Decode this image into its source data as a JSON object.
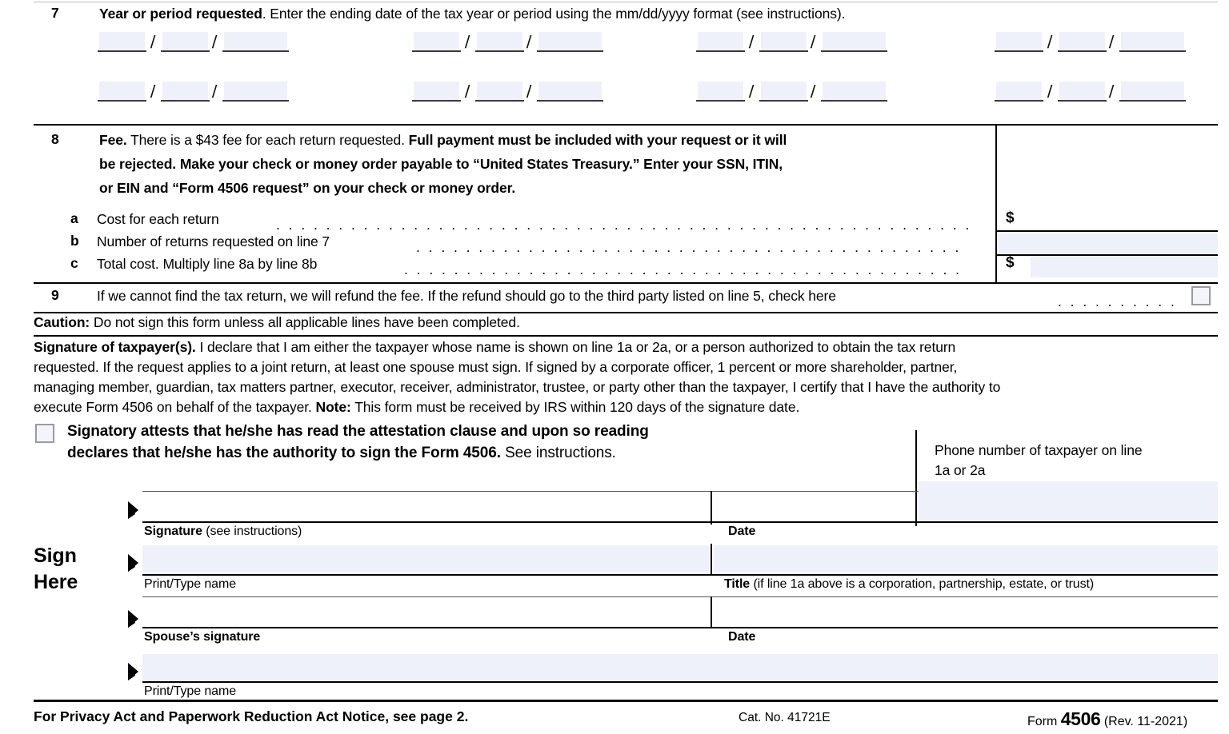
{
  "form": {
    "title": "Form 4506",
    "revision": "(Rev. 11-2021)",
    "catalog_number": "Cat. No. 41721E",
    "privacy_notice": "For Privacy Act and Paperwork Reduction Act Notice, see page 2.",
    "form_label": "Form",
    "form_number": "4506"
  },
  "line7": {
    "number": "7",
    "label_bold": "Year or period requested",
    "label_rest": ". Enter the ending date of the tax year or period using the mm/dd/yyyy format (see instructions).",
    "separator": "/",
    "date_groups": [
      {
        "month": "",
        "day": "",
        "year": ""
      },
      {
        "month": "",
        "day": "",
        "year": ""
      },
      {
        "month": "",
        "day": "",
        "year": ""
      },
      {
        "month": "",
        "day": "",
        "year": ""
      },
      {
        "month": "",
        "day": "",
        "year": ""
      },
      {
        "month": "",
        "day": "",
        "year": ""
      },
      {
        "month": "",
        "day": "",
        "year": ""
      },
      {
        "month": "",
        "day": "",
        "year": ""
      }
    ]
  },
  "line8": {
    "number": "8",
    "head_bold_1": "Fee.",
    "head_plain_1": " There is a $43 fee for each return requested. ",
    "head_bold_2": "Full payment must be included with your request or it will",
    "head_bold_3": "be rejected. Make your check or money order payable to “United States Treasury.” Enter your SSN, ITIN,",
    "head_bold_4": "or EIN and “Form 4506 request” on your check or money order.",
    "rows": [
      {
        "letter": "a",
        "text": "Cost for each return",
        "currency": "$",
        "value": ""
      },
      {
        "letter": "b",
        "text": "Number of returns requested on line 7",
        "currency": "",
        "value": ""
      },
      {
        "letter": "c",
        "text": "Total cost. Multiply line 8a by line 8b",
        "currency": "$",
        "value": ""
      }
    ]
  },
  "line9": {
    "number": "9",
    "text": "If we cannot find the tax return, we will refund the fee. If the refund should go to the third party listed on line 5, check here",
    "checkbox_checked": false
  },
  "caution": {
    "bold": "Caution:",
    "text": " Do not sign this form unless all applicable lines have been completed."
  },
  "signature_block": {
    "heading_bold": "Signature of taxpayer(s).",
    "para_line1": " I declare that I am either the taxpayer whose name is shown on line 1a or 2a, or a person authorized to obtain the tax return",
    "para_line2": "requested. If the request applies to a joint return, at least one spouse must sign. If signed by a corporate officer, 1 percent or more shareholder, partner,",
    "para_line3": "managing member, guardian, tax matters partner, executor, receiver, administrator, trustee, or party other than the taxpayer, I certify that I have the authority to",
    "para_line4_a": "execute Form 4506 on behalf of the taxpayer. ",
    "para_line4_note": "Note:",
    "para_line4_b": " This form must be received by IRS within 120 days of the signature date."
  },
  "attestation": {
    "checkbox_checked": false,
    "bold_line1": "Signatory attests that he/she has read the attestation clause and upon so reading",
    "bold_line2": "declares that he/she has the authority to sign the Form 4506.",
    "plain_line2": " See instructions."
  },
  "phone": {
    "label_line1": "Phone number of taxpayer on line",
    "label_line2": "1a or 2a",
    "value": ""
  },
  "sign_here": {
    "label_line1": "Sign",
    "label_line2": "Here",
    "rows": [
      {
        "left_label_bold": "Signature",
        "left_label_plain": " (see instructions)",
        "right_label_bold": "Date",
        "right_label_plain": "",
        "left_value": "",
        "right_value": ""
      },
      {
        "left_label_bold": "",
        "left_label_plain": "Print/Type name",
        "right_label_bold": "Title",
        "right_label_plain": " (if line 1a above is a corporation, partnership, estate, or trust)",
        "left_value": "",
        "right_value": ""
      },
      {
        "left_label_bold": "Spouse’s signature",
        "left_label_plain": "",
        "right_label_bold": "Date",
        "right_label_plain": "",
        "left_value": "",
        "right_value": ""
      },
      {
        "left_label_bold": "",
        "left_label_plain": "Print/Type name",
        "right_label_bold": "",
        "right_label_plain": "",
        "left_value": "",
        "right_value": ""
      }
    ]
  },
  "colors": {
    "field_fill": "#eff1fa",
    "rule": "#000000",
    "checkbox_border": "#9a9aa6"
  }
}
